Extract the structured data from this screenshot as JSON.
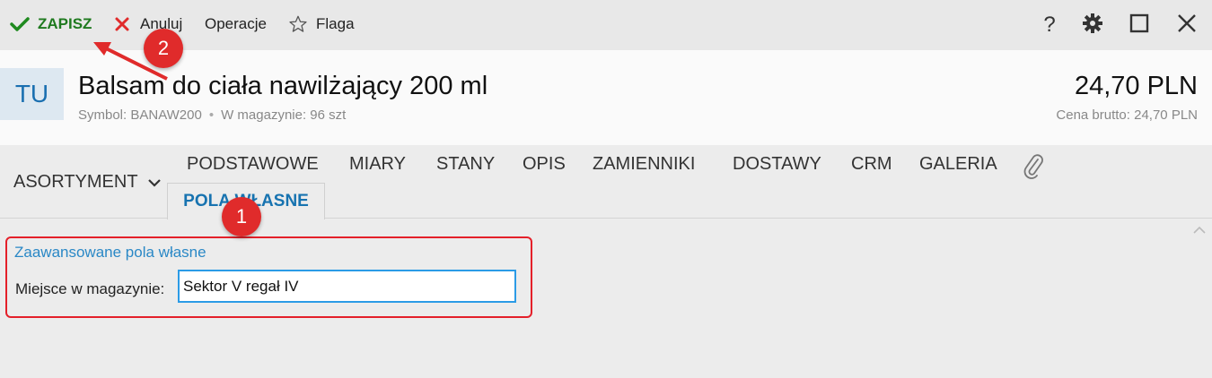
{
  "toolbar": {
    "save_label": "ZAPISZ",
    "cancel_label": "Anuluj",
    "operations_label": "Operacje",
    "flag_label": "Flaga",
    "help_label": "?"
  },
  "header": {
    "avatar_initials": "TU",
    "title": "Balsam do ciała nawilżający 200 ml",
    "symbol": "Symbol: BANAW200",
    "separator": "•",
    "stock": "W magazynie: 96 szt",
    "price": "24,70 PLN",
    "price_gross": "Cena brutto: 24,70 PLN"
  },
  "tabs": {
    "assortment": "ASORTYMENT",
    "items": [
      "PODSTAWOWE",
      "MIARY",
      "STANY",
      "OPIS",
      "ZAMIENNIKI",
      "DOSTAWY",
      "CRM",
      "GALERIA"
    ],
    "active": "POLA WŁASNE"
  },
  "content": {
    "group_title": "Zaawansowane pola własne",
    "field_label": "Miejsce w magazynie:",
    "field_value": "Sektor V regał IV"
  },
  "annotations": {
    "badge1": "1",
    "badge2": "2"
  },
  "colors": {
    "accent": "#1773b0",
    "save_green": "#1f7a1f",
    "cancel_red": "#e02b2b",
    "highlight_red": "#e4202a"
  },
  "icons": [
    "check-icon",
    "close-icon",
    "star-icon",
    "help-icon",
    "gear-icon",
    "maximize-icon",
    "window-close-icon",
    "chevron-down-icon",
    "paperclip-icon",
    "scroll-up-icon"
  ]
}
